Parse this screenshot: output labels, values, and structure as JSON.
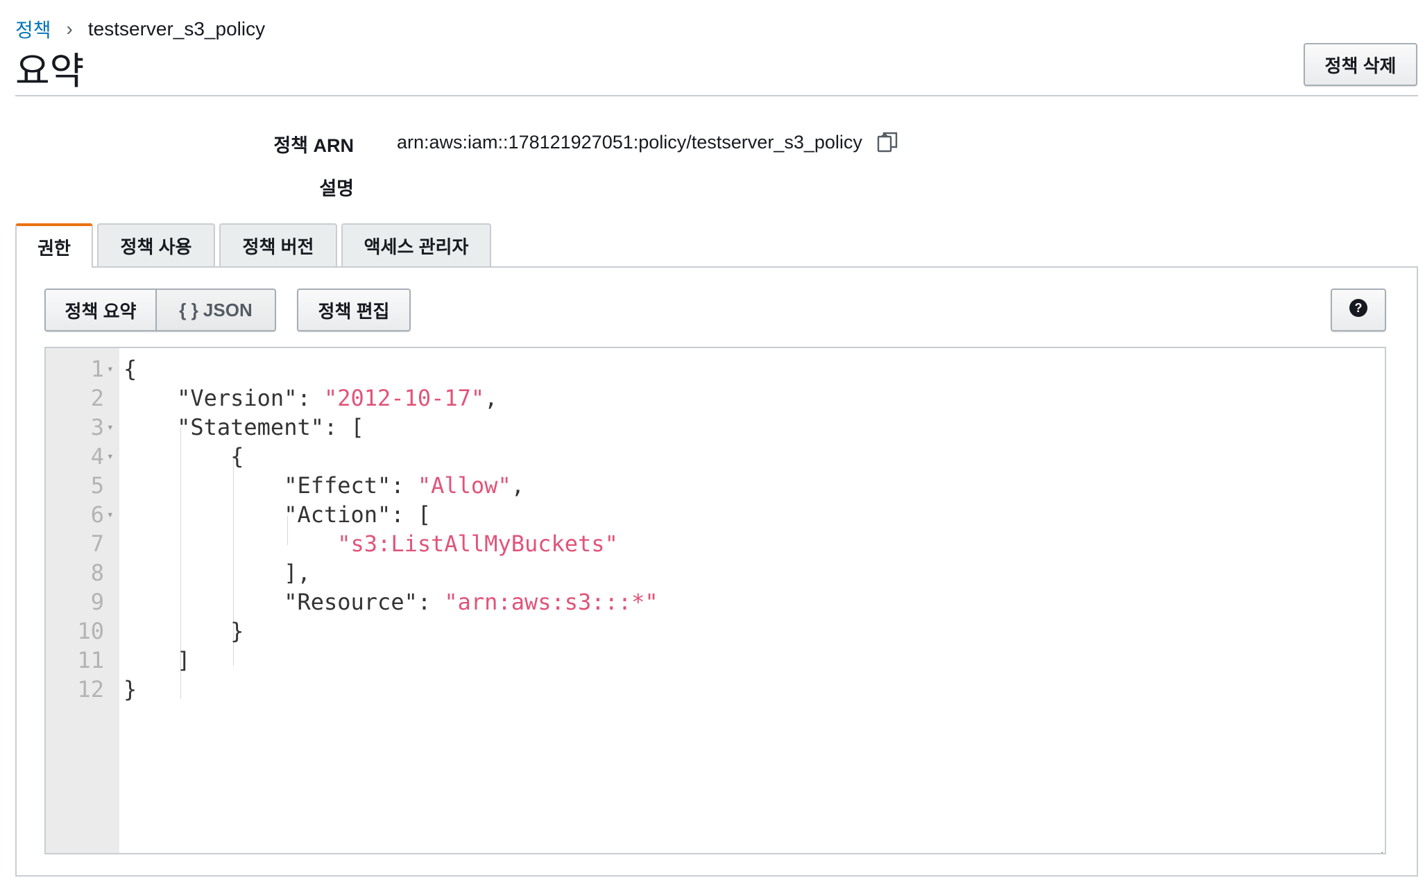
{
  "breadcrumb": {
    "parent": "정책",
    "separator": "›",
    "current": "testserver_s3_policy"
  },
  "page_title": "요약",
  "delete_button": "정책 삭제",
  "summary": {
    "arn_label": "정책 ARN",
    "arn_value": "arn:aws:iam::178121927051:policy/testserver_s3_policy",
    "description_label": "설명",
    "description_value": ""
  },
  "tabs": [
    {
      "label": "권한",
      "active": true
    },
    {
      "label": "정책 사용",
      "active": false
    },
    {
      "label": "정책 버전",
      "active": false
    },
    {
      "label": "액세스 관리자",
      "active": false
    }
  ],
  "view_toggle": {
    "summary_label": "정책 요약",
    "json_label": "{ } JSON",
    "selected": "json"
  },
  "edit_button": "정책 편집",
  "help_icon": "question-circle-icon",
  "colors": {
    "accent_tab": "#ec7211",
    "link": "#0073bb",
    "json_string": "#e0547a"
  },
  "editor": {
    "lines": [
      {
        "n": "1",
        "fold": true,
        "parts": [
          {
            "t": "{",
            "s": false
          }
        ]
      },
      {
        "n": "2",
        "fold": false,
        "parts": [
          {
            "t": "    \"Version\": ",
            "s": false
          },
          {
            "t": "\"2012-10-17\"",
            "s": true
          },
          {
            "t": ",",
            "s": false
          }
        ]
      },
      {
        "n": "3",
        "fold": true,
        "parts": [
          {
            "t": "    \"Statement\": [",
            "s": false
          }
        ]
      },
      {
        "n": "4",
        "fold": true,
        "parts": [
          {
            "t": "        {",
            "s": false
          }
        ]
      },
      {
        "n": "5",
        "fold": false,
        "parts": [
          {
            "t": "            \"Effect\": ",
            "s": false
          },
          {
            "t": "\"Allow\"",
            "s": true
          },
          {
            "t": ",",
            "s": false
          }
        ]
      },
      {
        "n": "6",
        "fold": true,
        "parts": [
          {
            "t": "            \"Action\": [",
            "s": false
          }
        ]
      },
      {
        "n": "7",
        "fold": false,
        "parts": [
          {
            "t": "                ",
            "s": false
          },
          {
            "t": "\"s3:ListAllMyBuckets\"",
            "s": true
          }
        ]
      },
      {
        "n": "8",
        "fold": false,
        "parts": [
          {
            "t": "            ],",
            "s": false
          }
        ]
      },
      {
        "n": "9",
        "fold": false,
        "parts": [
          {
            "t": "            \"Resource\": ",
            "s": false
          },
          {
            "t": "\"arn:aws:s3:::*\"",
            "s": true
          }
        ]
      },
      {
        "n": "10",
        "fold": false,
        "parts": [
          {
            "t": "        }",
            "s": false
          }
        ]
      },
      {
        "n": "11",
        "fold": false,
        "parts": [
          {
            "t": "    ]",
            "s": false
          }
        ]
      },
      {
        "n": "12",
        "fold": false,
        "parts": [
          {
            "t": "}",
            "s": false
          }
        ]
      }
    ]
  }
}
